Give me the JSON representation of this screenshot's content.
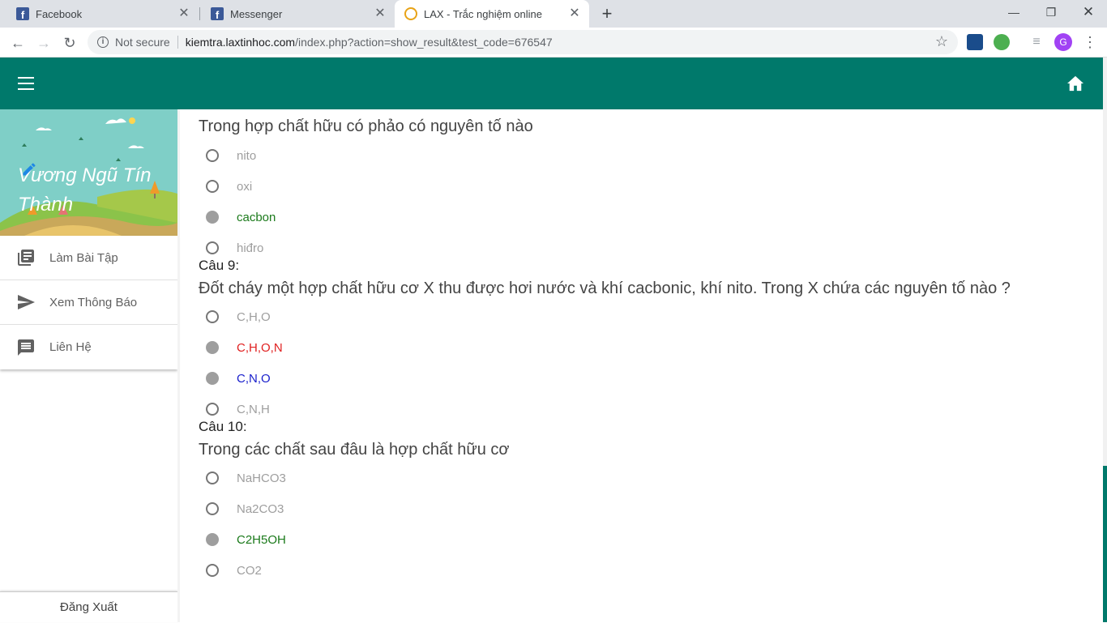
{
  "browser": {
    "tabs": [
      {
        "title": "Facebook"
      },
      {
        "title": "Messenger"
      },
      {
        "title": "LAX - Trắc nghiệm online"
      }
    ],
    "security_label": "Not secure",
    "url_host": "kiemtra.laxtinhoc.com",
    "url_path": "/index.php?action=show_result&test_code=676547",
    "profile_initial": "G"
  },
  "sidebar": {
    "user_name": "Vương Ngũ Tín Thành",
    "items": [
      {
        "label": "Làm Bài Tập",
        "icon": "library-books-icon"
      },
      {
        "label": "Xem Thông Báo",
        "icon": "send-icon"
      },
      {
        "label": "Liên Hệ",
        "icon": "message-icon"
      }
    ],
    "logout_label": "Đăng Xuất"
  },
  "questions": [
    {
      "label": "",
      "text": "Trong hợp chất hữu có phảo có nguyên tố nào",
      "options": [
        {
          "text": "nito",
          "checked": false,
          "color": "gray"
        },
        {
          "text": "oxi",
          "checked": false,
          "color": "gray"
        },
        {
          "text": "cacbon",
          "checked": true,
          "color": "green"
        },
        {
          "text": "hiđro",
          "checked": false,
          "color": "gray"
        }
      ]
    },
    {
      "label": "Câu 9:",
      "text": "Đốt cháy một hợp chất hữu cơ X thu được hơi nước và khí cacbonic, khí nito. Trong X chứa các nguyên tố nào ?",
      "options": [
        {
          "text": "C,H,O",
          "checked": false,
          "color": "gray"
        },
        {
          "text": "C,H,O,N",
          "checked": true,
          "color": "red"
        },
        {
          "text": "C,N,O",
          "checked": true,
          "color": "blue"
        },
        {
          "text": "C,N,H",
          "checked": false,
          "color": "gray"
        }
      ]
    },
    {
      "label": "Câu 10:",
      "text": "Trong các chất sau đâu là hợp chất hữu cơ",
      "options": [
        {
          "text": "NaHCO3",
          "checked": false,
          "color": "gray"
        },
        {
          "text": "Na2CO3",
          "checked": false,
          "color": "gray"
        },
        {
          "text": "C2H5OH",
          "checked": true,
          "color": "green"
        },
        {
          "text": "CO2",
          "checked": false,
          "color": "gray"
        }
      ]
    }
  ],
  "colors": {
    "appbar": "#00796b",
    "correct": "#1b7a1b",
    "wrong": "#e02020",
    "selected": "#1a20cc"
  }
}
